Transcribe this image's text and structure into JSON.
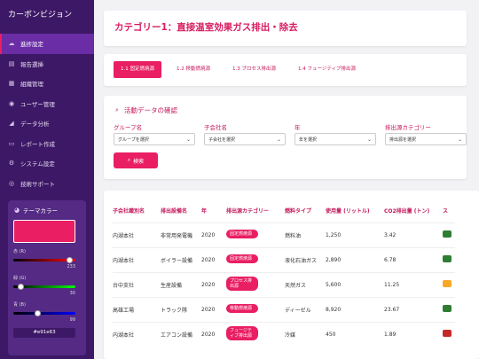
{
  "app": {
    "title": "カーボンビジョン"
  },
  "sidebar": {
    "items": [
      {
        "label": "進捗設定",
        "icon": "cloud-icon",
        "glyph": "☁"
      },
      {
        "label": "報告選挿",
        "icon": "document-icon",
        "glyph": "▤"
      },
      {
        "label": "組織管理",
        "icon": "building-icon",
        "glyph": "▦"
      },
      {
        "label": "ユーザー管理",
        "icon": "users-icon",
        "glyph": "◉"
      },
      {
        "label": "データ分析",
        "icon": "chart-icon",
        "glyph": "◢"
      },
      {
        "label": "レポート作成",
        "icon": "file-icon",
        "glyph": "▭"
      },
      {
        "label": "システム設定",
        "icon": "gear-icon",
        "glyph": "⚙"
      },
      {
        "label": "技術サポート",
        "icon": "help-icon",
        "glyph": "◎"
      }
    ]
  },
  "theme": {
    "title": "テーマカラー",
    "red_label": "赤 (R)",
    "red_value": "233",
    "green_label": "緑 (G)",
    "green_value": "30",
    "blue_label": "青 (B)",
    "blue_value": "99",
    "hex": "#e91e63",
    "red_level": 0.914,
    "green_level": 0.118,
    "blue_level": 0.388
  },
  "page": {
    "title": "カテゴリー1：直接温室効果ガス排出・除去"
  },
  "tabs": [
    {
      "label": "1.1 固定燃焼源",
      "active": true
    },
    {
      "label": "1.2 移動燃焼源",
      "active": false
    },
    {
      "label": "1.3 プロセス排出源",
      "active": false
    },
    {
      "label": "1.4 フュージティブ排出源",
      "active": false
    }
  ],
  "filter": {
    "title": "活動データの確認",
    "fields": [
      {
        "label": "グループ名",
        "value": "グループを選択"
      },
      {
        "label": "子会社名",
        "value": "子会社を選択"
      },
      {
        "label": "年",
        "value": "年を選択"
      },
      {
        "label": "排出源カテゴリー",
        "value": "排出源を選択"
      }
    ],
    "search_label": "検索"
  },
  "table": {
    "headers": [
      "子会社識別名",
      "排出設備名",
      "年",
      "排出源カテゴリー",
      "燃料タイプ",
      "使用量 (リットル)",
      "CO2排出量 (トン)",
      "ス"
    ],
    "rows": [
      {
        "company": "内湖本社",
        "equipment": "非常用発電機",
        "year": "2020",
        "category": "固定燃焼源",
        "fuel": "燃料油",
        "usage": "1,250",
        "co2": "3.42",
        "status_color": "#2e7d32"
      },
      {
        "company": "内湖本社",
        "equipment": "ボイラー設備",
        "year": "2020",
        "category": "固定燃焼源",
        "fuel": "液化石油ガス",
        "usage": "2,890",
        "co2": "6.78",
        "status_color": "#2e7d32"
      },
      {
        "company": "台中支社",
        "equipment": "生産設備",
        "year": "2020",
        "category": "プロセス排出源",
        "fuel": "天然ガス",
        "usage": "5,600",
        "co2": "11.25",
        "status_color": "#f9a825"
      },
      {
        "company": "高雄工場",
        "equipment": "トラック隊",
        "year": "2020",
        "category": "移動燃焼源",
        "fuel": "ディーゼル",
        "usage": "8,920",
        "co2": "23.67",
        "status_color": "#2e7d32"
      },
      {
        "company": "内湖本社",
        "equipment": "エアコン設備",
        "year": "2020",
        "category": "フュージティブ排出源",
        "fuel": "冷媒",
        "usage": "450",
        "co2": "1.89",
        "status_color": "#c62828"
      }
    ]
  }
}
